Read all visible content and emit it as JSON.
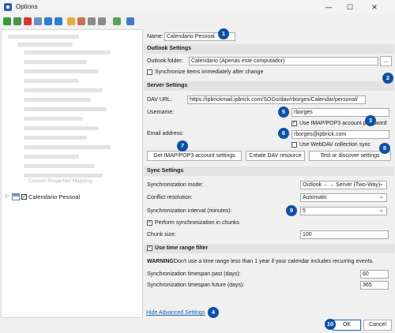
{
  "window": {
    "title": "Options",
    "minimize": "—",
    "maximize": "☐",
    "close": "✕"
  },
  "tree": {
    "item_label": "Calendario Pessoal",
    "blurred_label": "Custom Properties Mapping"
  },
  "name": {
    "label": "Name:",
    "value": "Calendario Pessoal"
  },
  "outlook": {
    "header": "Outlook Settings",
    "folder_label": "Outlook folder:",
    "folder_value": "Calendario (Apenas este computador)",
    "browse_label": "...",
    "sync_immediately_label": "Synchronize items immediately after change"
  },
  "server": {
    "header": "Server Settings",
    "dav_url_label": "DAV URL:",
    "dav_url_value": "https://ipbrickmail.ipbrick.com/SOGo/dav/rborges/Calendar/personal/",
    "username_label": "Username:",
    "username_value": "rborges",
    "use_imap_label": "Use IMAP/POP3 account password",
    "email_label": "Email address:",
    "email_value": "rborges@ipbrick.com",
    "use_webdav_label": "Use WebDAV collection sync",
    "get_imap_button": "Get IMAP/POP3 account settings",
    "create_dav_button": "Create DAV resource",
    "test_button": "Test or discover settings"
  },
  "sync": {
    "header": "Sync Settings",
    "mode_label": "Synchronization mode:",
    "mode_value": "Outlook ←→ Server (Two-Way)",
    "conflict_label": "Conflict resolution:",
    "conflict_value": "Automatic",
    "interval_label": "Synchronization interval (minutes):",
    "interval_value": "5",
    "chunks_label": "Perform synchronization in chunks",
    "chunk_size_label": "Chunk size:",
    "chunk_size_value": "100"
  },
  "time_range": {
    "header": "Use time range filter",
    "warning_bold": "WARNING:",
    "warning_text": "Don't use a time range less than 1 year if your calendar includes recurring events.",
    "past_label": "Synchronization timespan past (days):",
    "past_value": "60",
    "future_label": "Synchronization timespan future (days):",
    "future_value": "365"
  },
  "footer": {
    "hide_advanced": "Hide Advanced Settings",
    "ok": "OK",
    "cancel": "Cancel"
  },
  "badges": [
    "1",
    "2",
    "3",
    "4",
    "5",
    "6",
    "7",
    "8",
    "9",
    "10"
  ]
}
